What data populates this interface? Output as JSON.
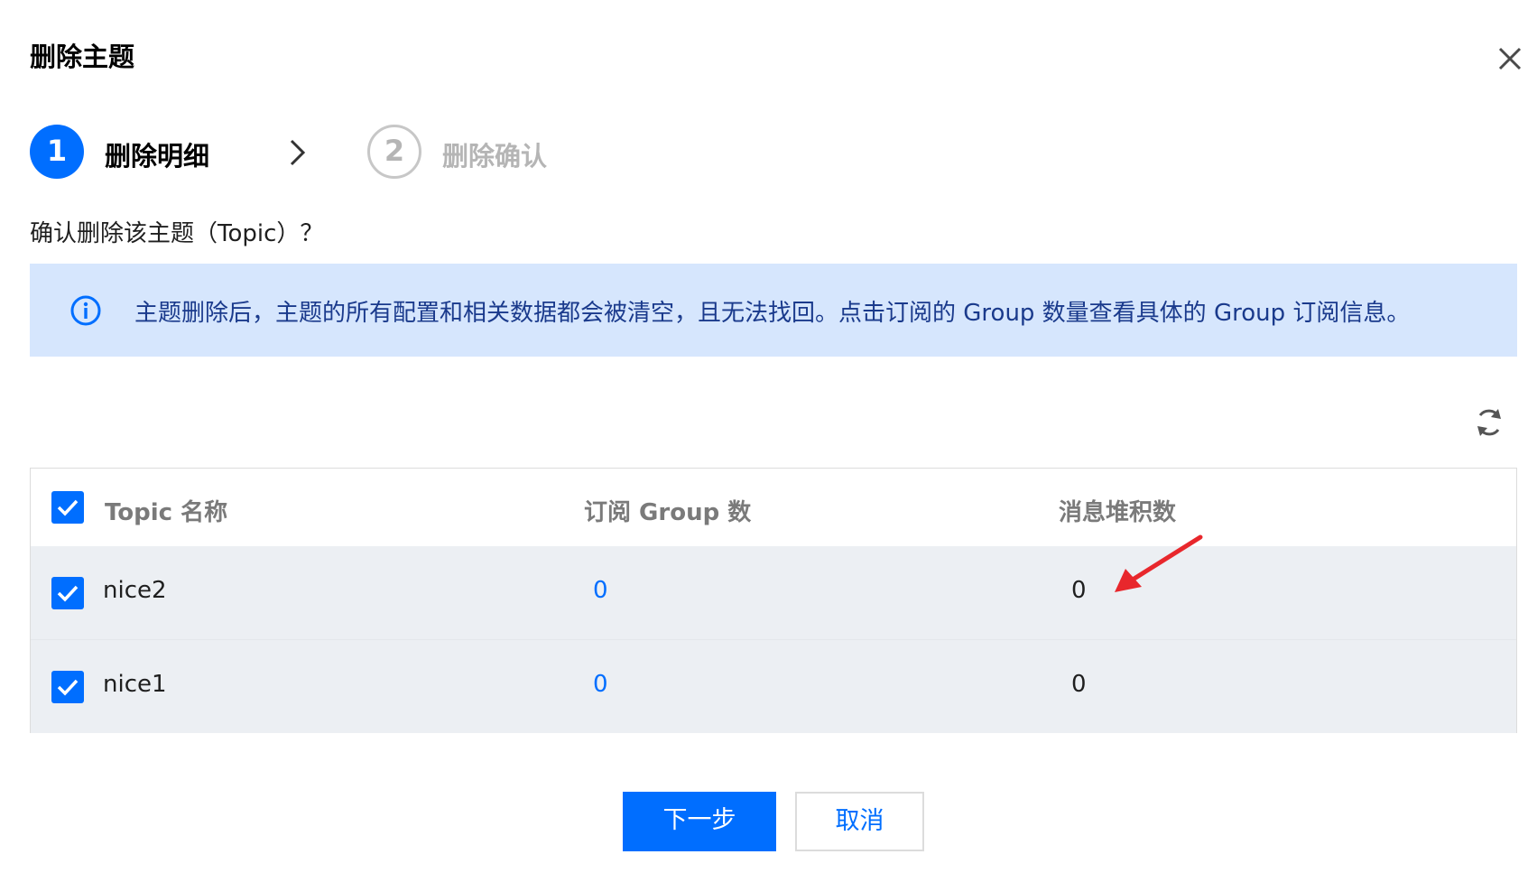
{
  "dialog": {
    "title": "删除主题"
  },
  "steps": [
    {
      "number": "1",
      "label": "删除明细",
      "state": "active"
    },
    {
      "number": "2",
      "label": "删除确认",
      "state": "inactive"
    }
  ],
  "question": "确认删除该主题（Topic）？",
  "info_banner": {
    "text": "主题删除后，主题的所有配置和相关数据都会被清空，且无法找回。点击订阅的 Group 数量查看具体的 Group 订阅信息。"
  },
  "table": {
    "headers": [
      "Topic 名称",
      "订阅 Group 数",
      "消息堆积数"
    ],
    "rows": [
      {
        "name": "nice2",
        "groups": "0",
        "backlog": "0"
      },
      {
        "name": "nice1",
        "groups": "0",
        "backlog": "0"
      }
    ]
  },
  "buttons": {
    "next": "下一步",
    "cancel": "取消"
  },
  "colors": {
    "primary": "#006eff",
    "banner_bg": "#d6e6fd",
    "row_bg": "#eceff3",
    "annotation": "#e8272c"
  },
  "icons": [
    "close-icon",
    "chevron-right-icon",
    "info-icon",
    "refresh-icon",
    "checkmark-icon",
    "annotation-arrow-icon"
  ]
}
